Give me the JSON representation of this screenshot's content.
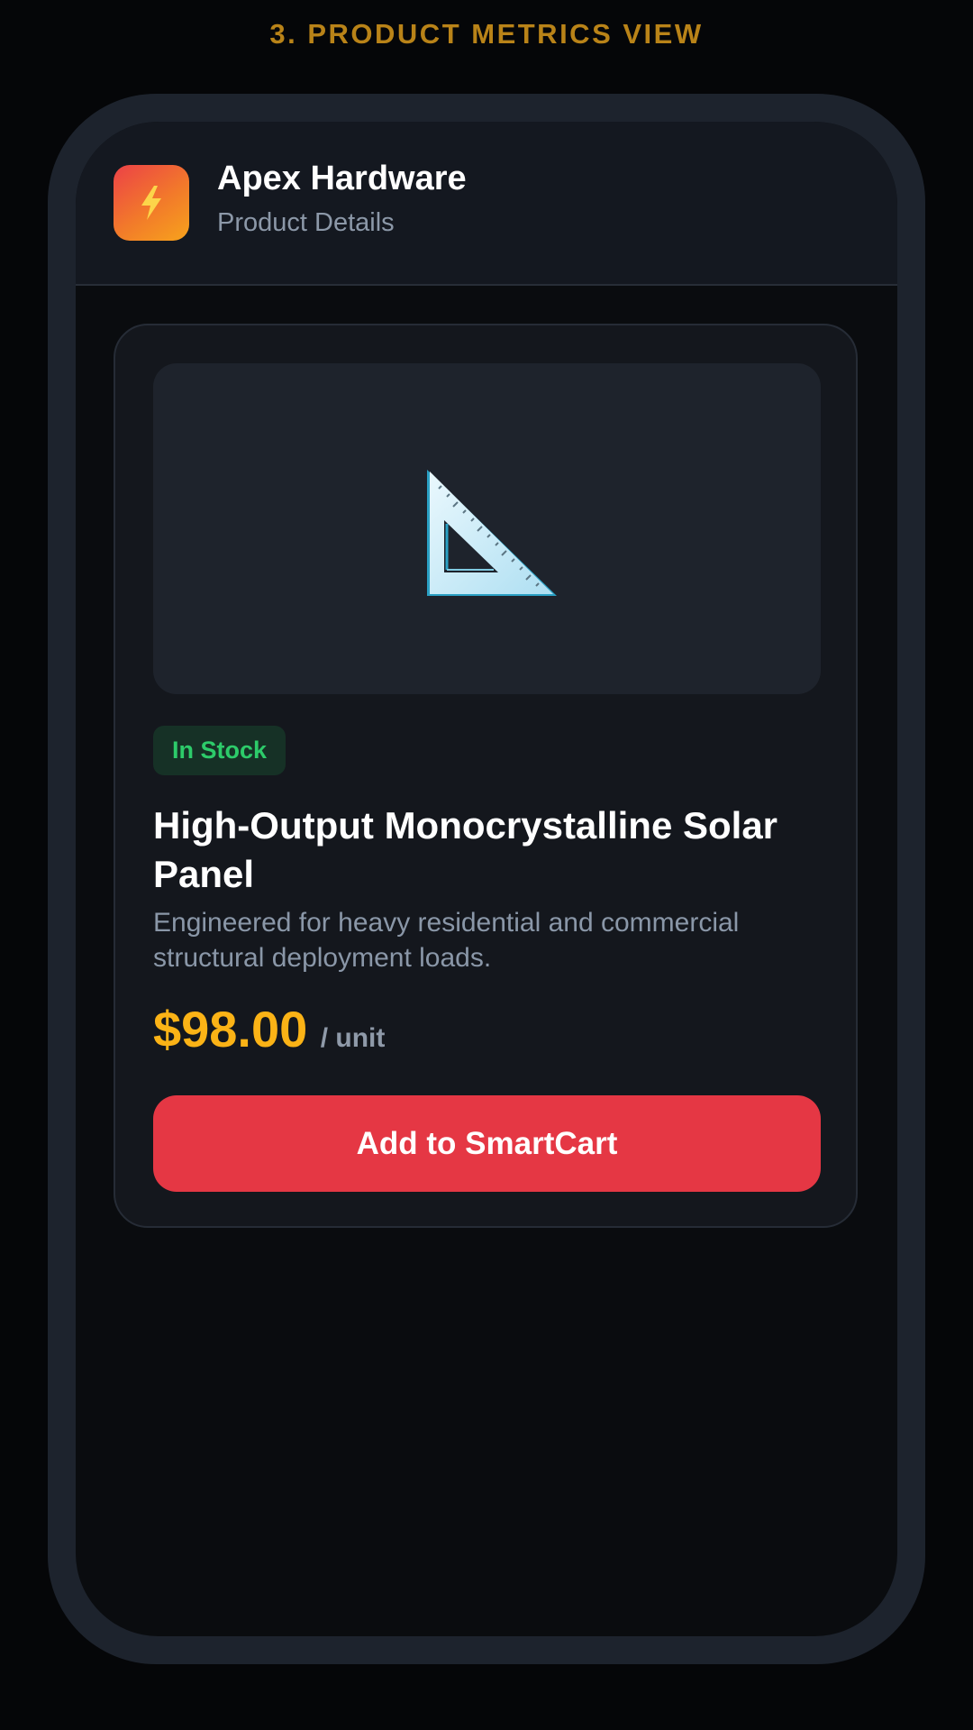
{
  "section": {
    "title": "3. PRODUCT METRICS VIEW"
  },
  "header": {
    "app_name": "Apex Hardware",
    "subtitle": "Product Details",
    "logo_icon": "lightning-bolt-icon"
  },
  "product": {
    "image_icon": "triangle-ruler-icon",
    "stock_status": "In Stock",
    "name": "High-Output Monocrystalline Solar Panel",
    "description": "Engineered for heavy residential and commercial structural deployment loads.",
    "price": "$98.00",
    "unit": "/ unit",
    "cta_label": "Add to SmartCart"
  },
  "colors": {
    "background": "#050608",
    "accent_price": "#fbb316",
    "cta_button": "#e53744",
    "in_stock": "#2dcb6a",
    "section_title": "#b98318"
  }
}
